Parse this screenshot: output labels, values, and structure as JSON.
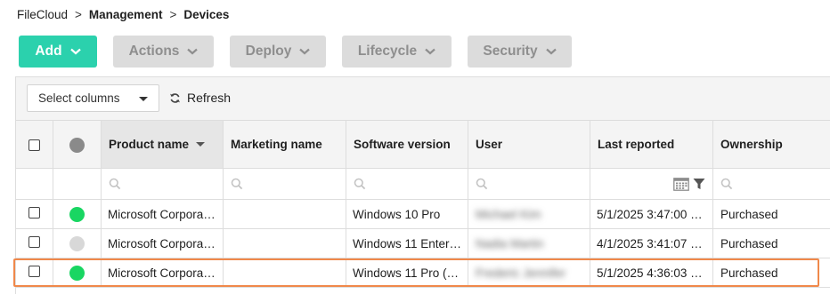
{
  "breadcrumb": {
    "root": "FileCloud",
    "sep1": ">",
    "section": "Management",
    "sep2": ">",
    "page": "Devices"
  },
  "toolbar": {
    "add": "Add",
    "actions": "Actions",
    "deploy": "Deploy",
    "lifecycle": "Lifecycle",
    "security": "Security"
  },
  "grid_toolbar": {
    "select_columns": "Select columns",
    "refresh": "Refresh"
  },
  "columns": {
    "product": "Product name",
    "marketing": "Marketing name",
    "software": "Software version",
    "user": "User",
    "last_reported": "Last reported",
    "ownership": "Ownership"
  },
  "colors": {
    "accent": "#2bd1ad",
    "online": "#19d662",
    "offline": "#d8d8d8",
    "highlight": "#f0884a"
  },
  "rows": [
    {
      "status": "online",
      "product": "Microsoft Corpora…",
      "marketing": "",
      "software": "Windows 10 Pro",
      "user": "Michael Kim",
      "last_reported": "5/1/2025 3:47:00 …",
      "ownership": "Purchased"
    },
    {
      "status": "offline",
      "product": "Microsoft Corpora…",
      "marketing": "",
      "software": "Windows 11 Enter…",
      "user": "Nadia Martin",
      "last_reported": "4/1/2025 3:41:07 …",
      "ownership": "Purchased"
    },
    {
      "status": "online",
      "product": "Microsoft Corpora…",
      "marketing": "",
      "software": "Windows 11 Pro (…",
      "user": "Frederic Jennifer",
      "last_reported": "5/1/2025 4:36:03 …",
      "ownership": "Purchased"
    }
  ]
}
